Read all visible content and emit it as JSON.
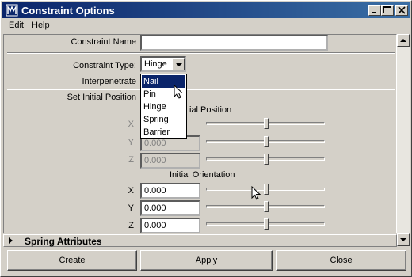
{
  "window": {
    "title": "Constraint Options"
  },
  "menu": {
    "items": [
      "Edit",
      "Help"
    ]
  },
  "form": {
    "constraint_name_label": "Constraint Name",
    "constraint_name_value": "",
    "constraint_type_label": "Constraint Type:",
    "constraint_type_value": "Hinge",
    "interpenetrate_label": "Interpenetrate",
    "set_initial_position_label": "Set Initial Position",
    "initial_position_label": "Initial Position",
    "initial_position_label_visible": "ial Position",
    "position": {
      "x_label": "X",
      "y_label": "Y",
      "z_label": "Z",
      "y_value": "0.000",
      "z_value": "0.000"
    },
    "initial_orientation_label": "Initial Orientation",
    "orientation": {
      "x_label": "X",
      "y_label": "Y",
      "z_label": "Z",
      "x_value": "0.000",
      "y_value": "0.000",
      "z_value": "0.000"
    }
  },
  "dropdown": {
    "options": [
      "Nail",
      "Pin",
      "Hinge",
      "Spring",
      "Barrier"
    ],
    "highlighted": "Nail"
  },
  "section": {
    "spring_attributes_label": "Spring Attributes"
  },
  "buttons": {
    "create": "Create",
    "apply": "Apply",
    "close": "Close"
  },
  "colors": {
    "titlebar": "#0a246a",
    "face": "#d4d0c8",
    "selection": "#0a246a"
  }
}
